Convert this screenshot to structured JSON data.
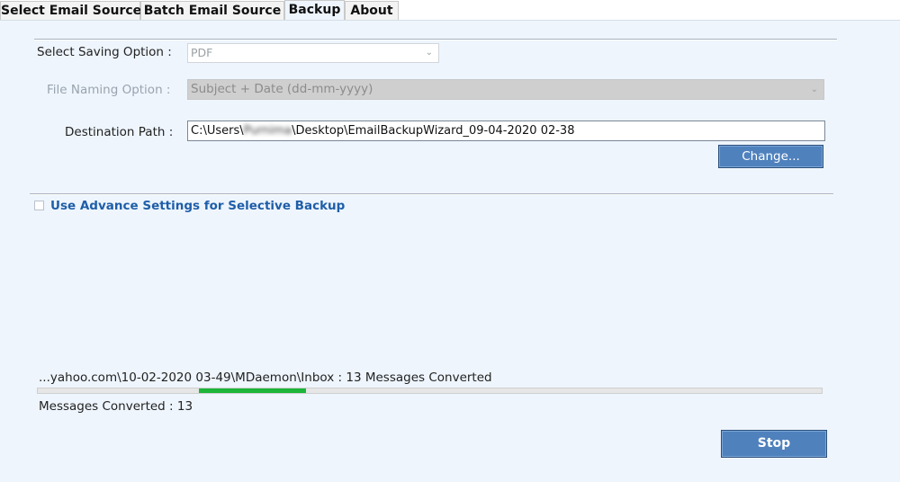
{
  "tabs": [
    {
      "label": "Select Email Source",
      "active": false
    },
    {
      "label": "Batch Email Source",
      "active": false
    },
    {
      "label": "Backup",
      "active": true
    },
    {
      "label": "About",
      "active": false
    }
  ],
  "saving_option": {
    "label": "Select Saving Option :",
    "value": "PDF"
  },
  "file_naming": {
    "label": "File Naming Option :",
    "value": "Subject + Date (dd-mm-yyyy)",
    "disabled": true
  },
  "destination": {
    "label": "Destination Path :",
    "path_prefix": "C:\\Users\\",
    "path_user": "Purnima",
    "path_suffix": "\\Desktop\\EmailBackupWizard_09-04-2020 02-38",
    "change_button": "Change..."
  },
  "advance_settings": {
    "label": "Use Advance Settings for Selective Backup",
    "checked": false
  },
  "progress": {
    "status_text": "...yahoo.com\\10-02-2020 03-49\\MDaemon\\Inbox : 13 Messages Converted",
    "converted_text": "Messages Converted : 13",
    "indicator": {
      "start_fraction": 0.205,
      "width_fraction": 0.137
    },
    "bar_color": "#1db53a"
  },
  "stop_button": "Stop",
  "icons": {
    "dropdown": "chevron-down-icon"
  },
  "colors": {
    "background": "#eef5fd",
    "button": "#4f81bd",
    "accent_text": "#1f5ea8"
  }
}
